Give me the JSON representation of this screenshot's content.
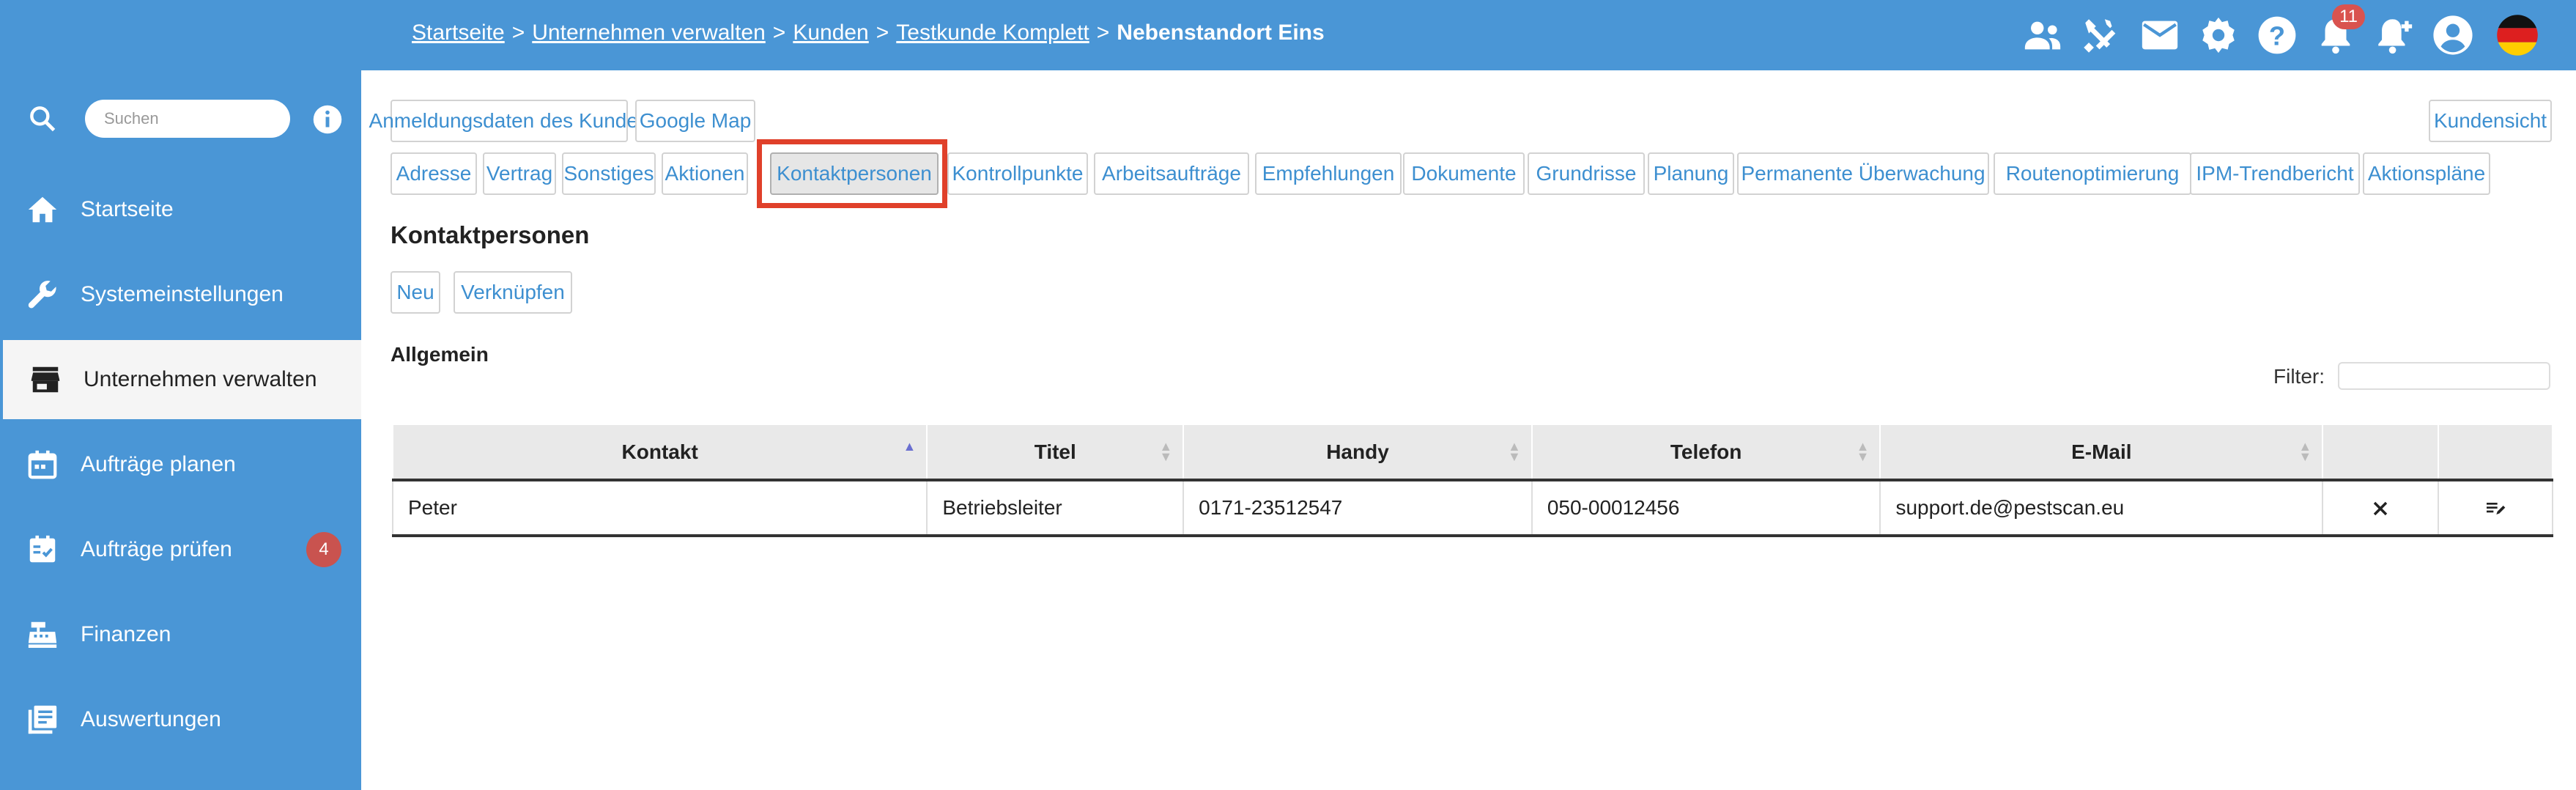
{
  "breadcrumb": {
    "items": [
      "Startseite",
      "Unternehmen verwalten",
      "Kunden",
      "Testkunde Komplett"
    ],
    "separator": ">",
    "current": "Nebenstandort Eins"
  },
  "topbar": {
    "notification_count": "11",
    "icons": [
      "users-icon",
      "tools-icon",
      "mail-icon",
      "gear-icon",
      "help-icon",
      "bell-icon",
      "bell-plus-icon",
      "account-icon",
      "flag-de-icon"
    ]
  },
  "sidebar": {
    "search_placeholder": "Suchen",
    "items": [
      {
        "label": "Startseite",
        "icon": "home-icon"
      },
      {
        "label": "Systemeinstellungen",
        "icon": "wrench-icon"
      },
      {
        "label": "Unternehmen verwalten",
        "icon": "store-icon",
        "active": true
      },
      {
        "label": "Aufträge planen",
        "icon": "calendar-icon"
      },
      {
        "label": "Aufträge prüfen",
        "icon": "calendar-check-icon",
        "badge": "4"
      },
      {
        "label": "Finanzen",
        "icon": "cash-register-icon"
      },
      {
        "label": "Auswertungen",
        "icon": "report-icon"
      }
    ]
  },
  "toolbar": {
    "login_data": "Anmeldungsdaten des Kunden",
    "google_map": "Google Map",
    "customer_view": "Kundensicht"
  },
  "tabs": [
    "Adresse",
    "Vertrag",
    "Sonstiges",
    "Aktionen",
    "Kontaktpersonen",
    "Kontrollpunkte",
    "Arbeitsaufträge",
    "Empfehlungen",
    "Dokumente",
    "Grundrisse",
    "Planung",
    "Permanente Überwachung",
    "Routenoptimierung",
    "IPM-Trendbericht",
    "Aktionspläne"
  ],
  "active_tab": "Kontaktpersonen",
  "section": {
    "title": "Kontaktpersonen",
    "new_label": "Neu",
    "link_label": "Verknüpfen",
    "group_title": "Allgemein",
    "filter_label": "Filter:"
  },
  "table": {
    "columns": [
      "Kontakt",
      "Titel",
      "Handy",
      "Telefon",
      "E-Mail"
    ],
    "rows": [
      {
        "kontakt": "Peter",
        "titel": "Betriebsleiter",
        "handy": "0171-23512547",
        "telefon": "050-00012456",
        "email": "support.de@pestscan.eu"
      }
    ]
  },
  "colors": {
    "primary": "#4a96d6",
    "link": "#3d8fd0",
    "highlight": "#e0402a",
    "badge": "#c9534f"
  }
}
